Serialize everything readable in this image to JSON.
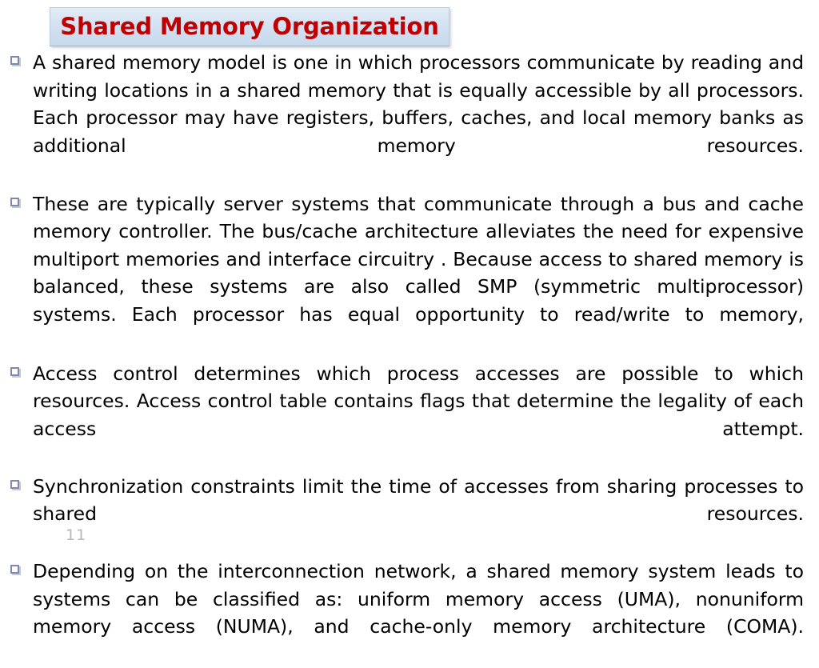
{
  "slide": {
    "title": "Shared Memory Organization",
    "title_color": "#c00000",
    "title_box_color": "#d4e2f1",
    "background_color": "#ffffff",
    "page_number": "11",
    "bullet_glyph": "hollow-square-bullet",
    "bullets": [
      {
        "text": "A shared memory model is one in which processors communicate by reading and writing locations in a shared memory that is equally accessible by all processors. Each processor may have registers, buffers, caches, and local memory banks as additional memory resources."
      },
      {
        "text": " These are typically server systems that communicate through a bus and cache memory controller. The bus/cache architecture alleviates the need for expensive multiport memories and interface circuitry . Because access to shared memory is balanced, these systems are also called SMP (symmetric multiprocessor) systems. Each processor has equal opportunity to read/write to memory,"
      },
      {
        "text": "Access control determines which process accesses are possible to which resources. Access control table contains flags that determine the legality of each access attempt."
      },
      {
        "text": "Synchronization constraints limit the time of accesses from sharing processes to shared resources."
      },
      {
        "text": "Depending on the interconnection network, a shared memory system leads to systems can be classified as: uniform memory access (UMA), nonuniform memory access (NUMA), and cache-only memory architecture (COMA)."
      }
    ]
  }
}
